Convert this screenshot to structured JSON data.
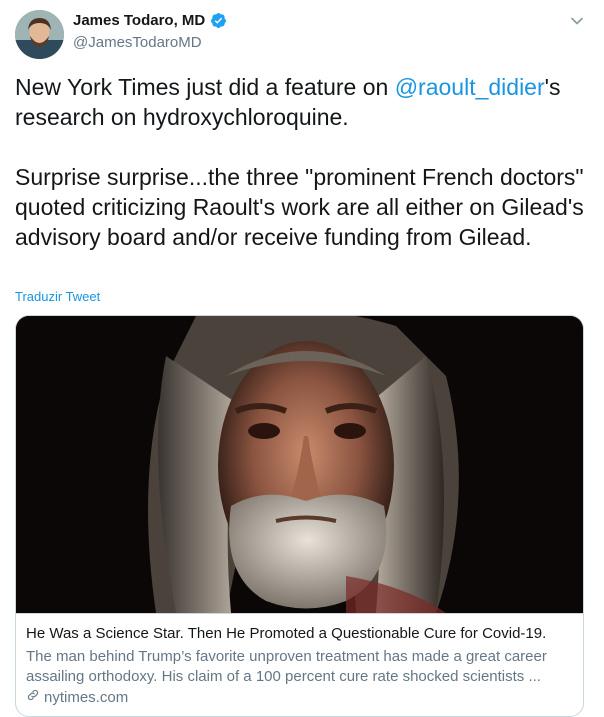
{
  "author": {
    "name": "James Todaro, MD",
    "handle": "@JamesTodaroMD",
    "verified_icon": "verified-badge-icon",
    "avatar_icon": "profile-avatar"
  },
  "menu": {
    "icon": "chevron-down-icon"
  },
  "tweet": {
    "text_before": "New York Times just did a feature on ",
    "mention": "@raoult_didier",
    "text_after": "'s research on hydroxychloroquine.\n\nSurprise surprise...the three \"prominent French doctors\" quoted criticizing Raoult's work are all either on Gilead's advisory board and/or receive funding from Gilead."
  },
  "translate_label": "Traduzir Tweet",
  "card": {
    "image_icon": "portrait-photo",
    "title": "He Was a Science Star. Then He Promoted a Questionable Cure for Covid-19.",
    "description": "The man behind Trump’s favorite unproven treatment has made a great career assailing orthodoxy. His claim of a 100 percent cure rate shocked scientists ...",
    "domain": "nytimes.com",
    "link_icon": "link-icon"
  },
  "colors": {
    "accent": "#1b95e0",
    "text": "#14171a",
    "muted": "#657786",
    "border": "#ccd6dd"
  }
}
